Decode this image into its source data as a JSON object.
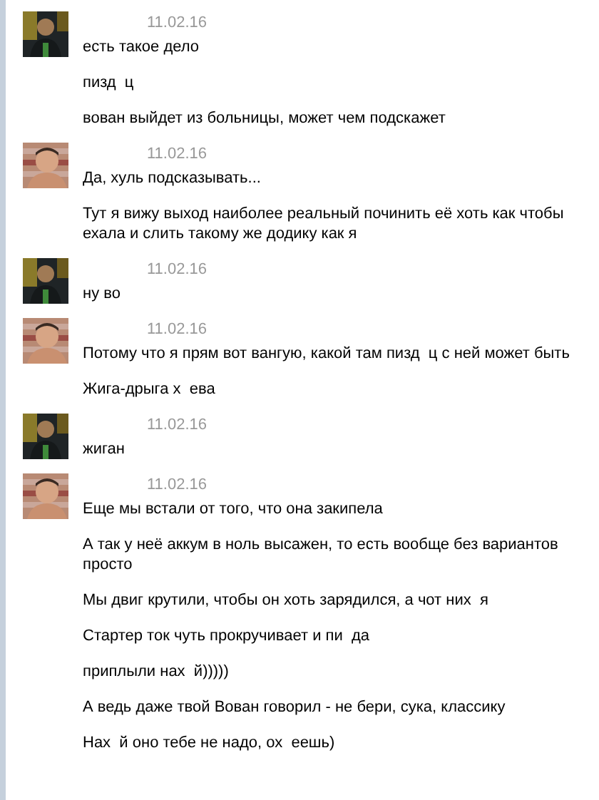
{
  "groups": [
    {
      "date": "11.02.16",
      "messages": [
        "есть такое дело",
        "пизд  ц",
        "вован выйдет из больницы, может чем подскажет"
      ]
    },
    {
      "date": "11.02.16",
      "messages": [
        "Да, хуль подсказывать...",
        "Тут я вижу выход наиболее реальный починить её хоть как чтобы ехала и слить такому же додику как я"
      ]
    },
    {
      "date": "11.02.16",
      "messages": [
        "ну во"
      ]
    },
    {
      "date": "11.02.16",
      "messages": [
        "Потому что я прям вот вангую, какой там пизд  ц с ней может быть",
        "Жига-дрыга х  ева"
      ]
    },
    {
      "date": "11.02.16",
      "messages": [
        "жиган"
      ]
    },
    {
      "date": "11.02.16",
      "messages": [
        "Еще мы встали от того, что она закипела",
        "А так у неё аккум в ноль высажен, то есть вообще без вариантов просто",
        "Мы двиг крутили, чтобы он хоть зарядился, а чот них  я",
        "Стартер ток чуть прокручивает и пи  да",
        "приплыли нах  й)))))",
        "А ведь даже твой Вован говорил - не бери, сука, классику",
        "Нах  й оно тебе не надо, ох  еешь)"
      ]
    }
  ]
}
